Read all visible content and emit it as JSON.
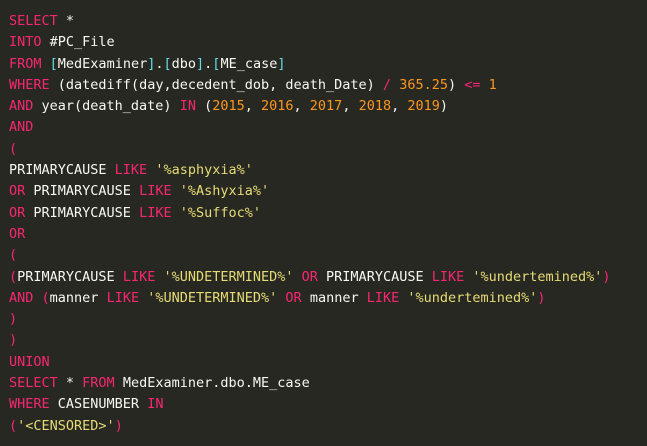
{
  "editor": {
    "background": "#272822",
    "colors": {
      "keyword": "#f92672",
      "plain": "#f8f8f2",
      "string": "#e6db74",
      "number": "#fd971f",
      "bracket": "#66d9ef"
    },
    "lines": [
      [
        [
          "kw",
          "SELECT"
        ],
        [
          "pl",
          " *"
        ]
      ],
      [
        [
          "kw",
          "INTO"
        ],
        [
          "pl",
          " #PC_File"
        ]
      ],
      [
        [
          "kw",
          "FROM"
        ],
        [
          "pl",
          " "
        ],
        [
          "brk",
          "["
        ],
        [
          "pl",
          "MedExaminer"
        ],
        [
          "brk",
          "]"
        ],
        [
          "pl",
          "."
        ],
        [
          "brk",
          "["
        ],
        [
          "pl",
          "dbo"
        ],
        [
          "brk",
          "]"
        ],
        [
          "pl",
          "."
        ],
        [
          "brk",
          "["
        ],
        [
          "pl",
          "ME_case"
        ],
        [
          "brk",
          "]"
        ]
      ],
      [
        [
          "kw",
          "WHERE"
        ],
        [
          "pl",
          " ("
        ],
        [
          "fn",
          "datediff"
        ],
        [
          "pl",
          "(day,decedent_dob, death_Date) "
        ],
        [
          "kw",
          "/"
        ],
        [
          "pl",
          " "
        ],
        [
          "num",
          "365.25"
        ],
        [
          "pl",
          ") "
        ],
        [
          "kw",
          "<="
        ],
        [
          "pl",
          " "
        ],
        [
          "num",
          "1"
        ]
      ],
      [
        [
          "kw",
          "AND"
        ],
        [
          "pl",
          " year(death_date) "
        ],
        [
          "kw",
          "IN"
        ],
        [
          "pl",
          " ("
        ],
        [
          "num",
          "2015"
        ],
        [
          "pl",
          ", "
        ],
        [
          "num",
          "2016"
        ],
        [
          "pl",
          ", "
        ],
        [
          "num",
          "2017"
        ],
        [
          "pl",
          ", "
        ],
        [
          "num",
          "2018"
        ],
        [
          "pl",
          ", "
        ],
        [
          "num",
          "2019"
        ],
        [
          "pl",
          ")"
        ]
      ],
      [
        [
          "kw",
          "AND"
        ]
      ],
      [
        [
          "kw",
          "("
        ]
      ],
      [
        [
          "pl",
          "PRIMARYCAUSE "
        ],
        [
          "kw",
          "LIKE"
        ],
        [
          "pl",
          " "
        ],
        [
          "str",
          "'%asphyxia%'"
        ]
      ],
      [
        [
          "kw",
          "OR"
        ],
        [
          "pl",
          " PRIMARYCAUSE "
        ],
        [
          "kw",
          "LIKE"
        ],
        [
          "pl",
          " "
        ],
        [
          "str",
          "'%Ashyxia%'"
        ]
      ],
      [
        [
          "kw",
          "OR"
        ],
        [
          "pl",
          " PRIMARYCAUSE "
        ],
        [
          "kw",
          "LIKE"
        ],
        [
          "pl",
          " "
        ],
        [
          "str",
          "'%Suffoc%'"
        ]
      ],
      [
        [
          "kw",
          "OR"
        ]
      ],
      [
        [
          "kw",
          "("
        ]
      ],
      [
        [
          "kw",
          "("
        ],
        [
          "pl",
          "PRIMARYCAUSE "
        ],
        [
          "kw",
          "LIKE"
        ],
        [
          "pl",
          " "
        ],
        [
          "str",
          "'%UNDETERMINED%'"
        ],
        [
          "pl",
          " "
        ],
        [
          "kw",
          "OR"
        ],
        [
          "pl",
          " PRIMARYCAUSE "
        ],
        [
          "kw",
          "LIKE"
        ],
        [
          "pl",
          " "
        ],
        [
          "str",
          "'%undertemined%'"
        ],
        [
          "kw",
          ")"
        ]
      ],
      [
        [
          "kw",
          "AND"
        ],
        [
          "pl",
          " "
        ],
        [
          "kw",
          "("
        ],
        [
          "pl",
          "manner "
        ],
        [
          "kw",
          "LIKE"
        ],
        [
          "pl",
          " "
        ],
        [
          "str",
          "'%UNDETERMINED%'"
        ],
        [
          "pl",
          " "
        ],
        [
          "kw",
          "OR"
        ],
        [
          "pl",
          " manner "
        ],
        [
          "kw",
          "LIKE"
        ],
        [
          "pl",
          " "
        ],
        [
          "str",
          "'%undertemined%'"
        ],
        [
          "kw",
          ")"
        ]
      ],
      [
        [
          "kw",
          ")"
        ]
      ],
      [
        [
          "kw",
          ")"
        ]
      ],
      [
        [
          "kw",
          "UNION"
        ]
      ],
      [
        [
          "kw",
          "SELECT"
        ],
        [
          "pl",
          " * "
        ],
        [
          "kw",
          "FROM"
        ],
        [
          "pl",
          " MedExaminer.dbo.ME_case"
        ]
      ],
      [
        [
          "kw",
          "WHERE"
        ],
        [
          "pl",
          " CASENUMBER "
        ],
        [
          "kw",
          "IN"
        ]
      ],
      [
        [
          "kw",
          "("
        ],
        [
          "str",
          "'<CENSORED>'"
        ],
        [
          "kw",
          ")"
        ]
      ]
    ]
  }
}
